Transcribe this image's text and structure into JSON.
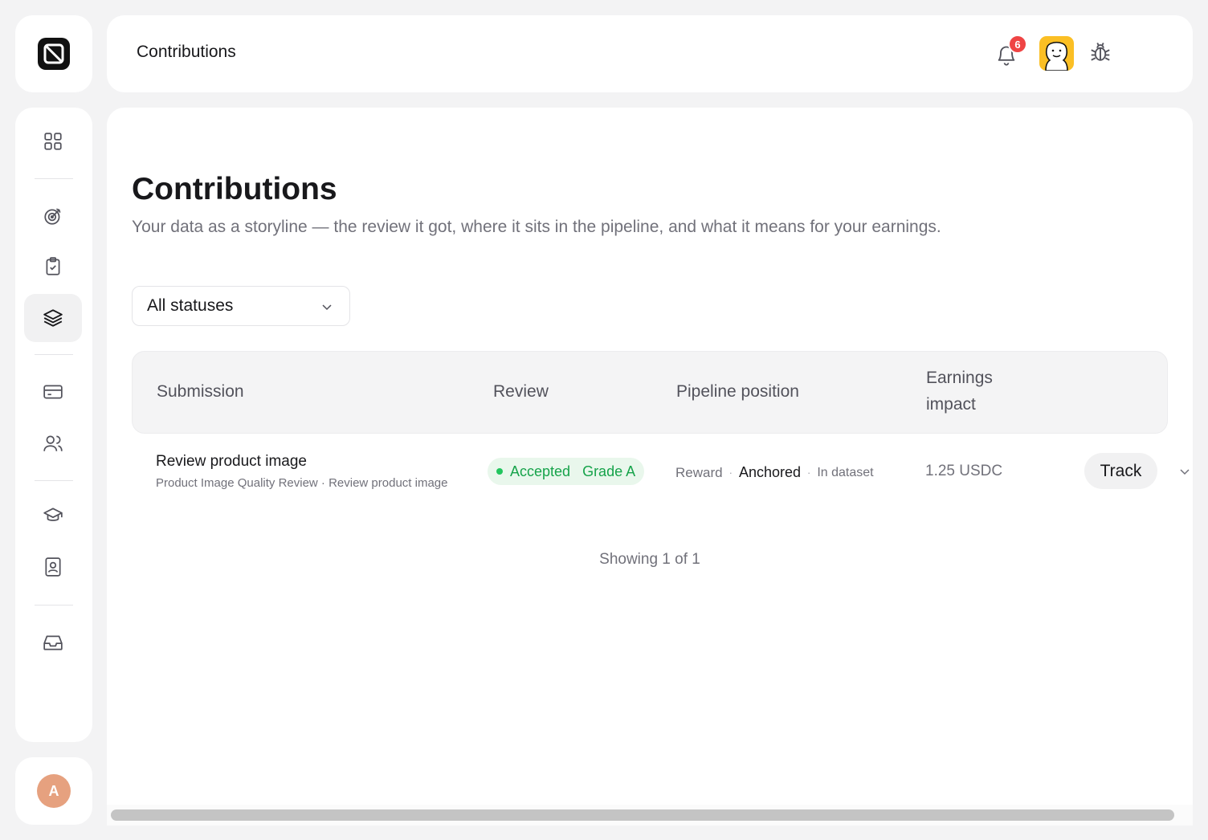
{
  "app": {
    "logo_icon": "brand-logo-icon"
  },
  "sidebar": {
    "items": [
      {
        "id": "dashboard",
        "icon": "grid-icon",
        "active": false
      },
      {
        "id": "goals",
        "icon": "target-icon",
        "active": false
      },
      {
        "id": "tasks",
        "icon": "clipboard-check-icon",
        "active": false
      },
      {
        "id": "contributions",
        "icon": "layers-icon",
        "active": true
      },
      {
        "id": "payments",
        "icon": "credit-card-icon",
        "active": false
      },
      {
        "id": "team",
        "icon": "users-icon",
        "active": false
      },
      {
        "id": "learning",
        "icon": "graduation-cap-icon",
        "active": false
      },
      {
        "id": "profile",
        "icon": "id-badge-icon",
        "active": false
      },
      {
        "id": "inbox",
        "icon": "inbox-icon",
        "active": false
      }
    ],
    "user_initial": "A"
  },
  "topbar": {
    "title": "Contributions",
    "notification_count": "6",
    "icons": [
      "bell-icon",
      "mascot-avatar",
      "bug-icon"
    ]
  },
  "page": {
    "title": "Contributions",
    "subtitle": "Your data as a storyline — the review it got, where it sits in the pipeline, and what it means for your earnings."
  },
  "filter": {
    "selected": "All statuses"
  },
  "table": {
    "headers": {
      "submission": "Submission",
      "review": "Review",
      "pipeline": "Pipeline position",
      "earnings_line1": "Earnings",
      "earnings_line2": "impact"
    },
    "rows": [
      {
        "title": "Review product image",
        "meta": "Product Image Quality Review · Review product image",
        "review_status": "Accepted",
        "review_grade": "Grade A",
        "pipeline_stage1": "Reward",
        "pipeline_stage2": "Anchored",
        "pipeline_stage3": "In dataset",
        "earnings": "1.25 USDC",
        "action_label": "Track"
      }
    ],
    "footer": "Showing 1 of 1"
  },
  "colors": {
    "accent_success": "#16a34a",
    "success_bg": "#e9f7ec",
    "badge_red": "#ef4444",
    "avatar_bg": "#e6a17f",
    "mascot_bg": "#fbbf24"
  }
}
